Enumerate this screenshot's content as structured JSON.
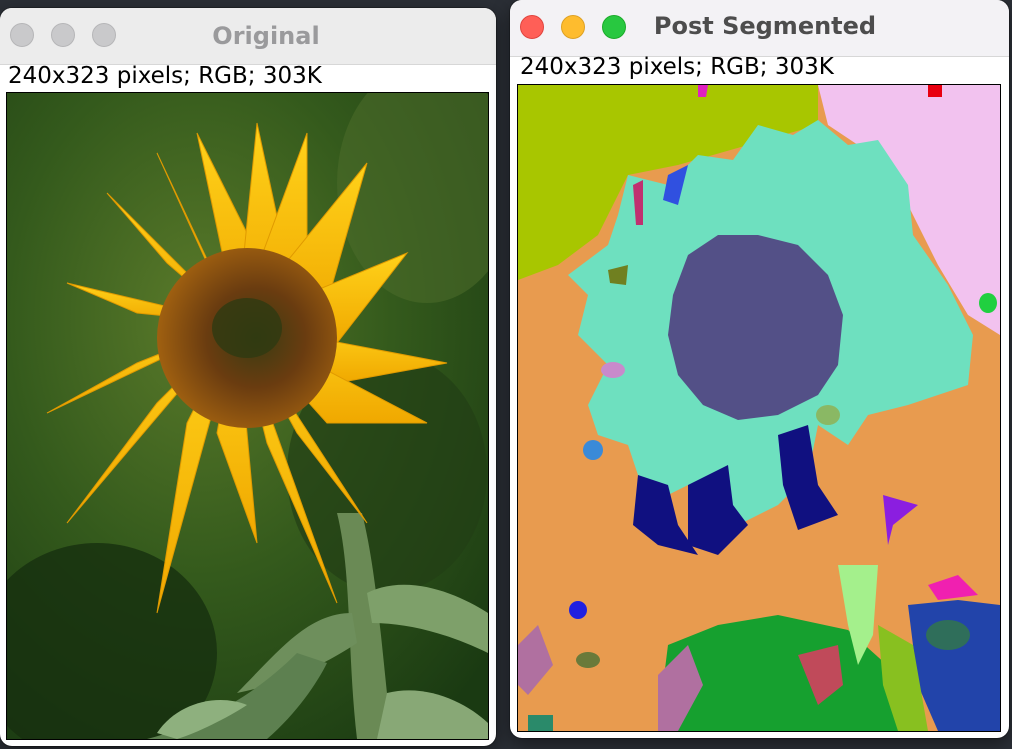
{
  "windows": {
    "original": {
      "title": "Original",
      "info": "240x323 pixels; RGB; 303K"
    },
    "segmented": {
      "title": "Post Segmented",
      "info": "240x323 pixels; RGB; 303K"
    }
  },
  "colors": {
    "close": "#ff5f57",
    "minimize": "#febc2e",
    "zoom": "#28c840",
    "segment_petals": "#6ee0bf",
    "segment_center": "#535087",
    "segment_background": "#e89b4f",
    "segment_topleft": "#a8c600",
    "segment_topright": "#f2c2ef",
    "segment_shadow": "#101080",
    "segment_leaves": "#16a02f"
  }
}
